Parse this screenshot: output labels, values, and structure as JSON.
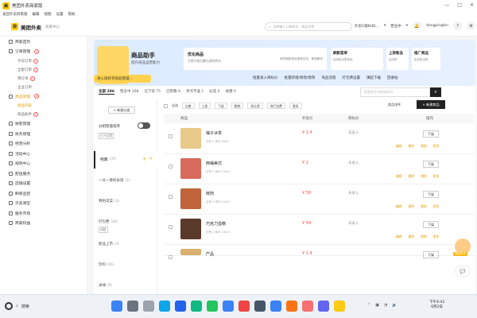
{
  "window": {
    "title": "美团外卖商家版",
    "controls": [
      "—",
      "□",
      "✕"
    ]
  },
  "menubar": [
    "美团外卖商家版",
    "编辑",
    "视图",
    "设置",
    "帮助"
  ],
  "header": {
    "brand": "美团外卖",
    "brand_sub": "商家中心",
    "search_placeholder": "支持输入订单尾号、商品名等",
    "store": "外卖C端KHD…",
    "status": "营业中",
    "user": "dongpingbin"
  },
  "sidebar": {
    "items": [
      {
        "label": "商家首页"
      },
      {
        "label": "订单管理",
        "badge": "1"
      },
      {
        "label": "今日订单",
        "sub": true,
        "badge": "1"
      },
      {
        "label": "全部订单",
        "sub": true,
        "badge": "2"
      },
      {
        "label": "预订单",
        "sub": true,
        "badge": "2"
      },
      {
        "label": "企业订单",
        "sub": true
      },
      {
        "label": "商品管理",
        "active": true,
        "badge": "4"
      },
      {
        "label": "商品列表",
        "sub": true,
        "active": true
      },
      {
        "label": "商品助手",
        "sub": true,
        "badge": "6"
      },
      {
        "label": "顾客管理"
      },
      {
        "label": "财务管理"
      },
      {
        "label": "经营分析"
      },
      {
        "label": "活动中心"
      },
      {
        "label": "规则中心"
      },
      {
        "label": "配送服务"
      },
      {
        "label": "店铺设置"
      },
      {
        "label": "刷单监控"
      },
      {
        "label": "外卖课堂"
      },
      {
        "label": "服务市场"
      },
      {
        "label": "商家权益"
      }
    ]
  },
  "banner": {
    "title": "商品助手",
    "subtitle": "提升商品运营能力",
    "card1": {
      "title": "优化商品",
      "desc": "可提升商品曝光度和转化",
      "right": "新时期新商品更受欢迎，敬请期待"
    },
    "card2": {
      "title": "刷新菜单",
      "desc": "如出售出售菜品"
    },
    "card3": {
      "title": "上架新品",
      "desc": "如出售"
    },
    "card4": {
      "title": "推广商品",
      "desc": "如出售出售"
    },
    "entry_button": "进入商好货商品管理 ›"
  },
  "actions": [
    "批量录入目标价",
    "批量新增/修改/修改",
    "商品流程",
    "打包费设置",
    "填起下载",
    "回收站"
  ],
  "tabs": [
    "全部 286",
    "售卖中 168",
    "已下架 75",
    "已售罄 6",
    "单点不送 1",
    "必选 0",
    "关键 0"
  ],
  "product_search_placeholder": "搜索商品名称或条码",
  "categories": {
    "add_button": "+ 新建分类",
    "smart_sort_label": "分组智能排序",
    "smart_sort_tag": "打开设置",
    "selected": "经典",
    "selected_count": "(37)",
    "items": [
      {
        "label": "一分一香奶米饭",
        "count": "(1)"
      },
      {
        "label": "特色凉菜",
        "count": "(3)"
      },
      {
        "label": "打包费",
        "count": "(26)",
        "sub": "调整"
      },
      {
        "label": "新品上市",
        "count": "(3)"
      },
      {
        "label": "饮料",
        "count": "(16)"
      },
      {
        "label": "米线",
        "count": "(9)"
      }
    ]
  },
  "toolbar": {
    "select_all": "全选",
    "buttons": [
      "出售",
      "上架",
      "下架",
      "删除",
      "改分类",
      "改打包费",
      "更多"
    ],
    "sort": "商品排序",
    "new_product": "+ 新建商品"
  },
  "table": {
    "headers": {
      "product": "商品",
      "price": "外卖价",
      "target": "目标价",
      "op": "操作"
    },
    "rows": [
      {
        "name": "柚子冰茶",
        "meta": "月售 0  库存 9996",
        "price": "¥ 1.4",
        "target": "未录入",
        "btn": "下架",
        "links": [
          "编辑",
          "删除",
          "替换",
          "更多"
        ]
      },
      {
        "name": "西柚美式",
        "meta": "月售 0  库存 10000",
        "price": "¥ 2",
        "target": "未录入",
        "btn": "下架",
        "links": [
          "编辑",
          "删除",
          "替换",
          "更多"
        ]
      },
      {
        "name": "鲜肉",
        "meta": "月售 0  库存 10000",
        "price": "¥ 58",
        "target": "未录入",
        "btn": "下架",
        "links": [
          "编辑",
          "删除",
          "替换",
          "更多"
        ]
      },
      {
        "name": "巧克力蛋糕",
        "meta": "月售 0  库存 10000",
        "price": "¥ 99",
        "target": "未录入",
        "btn": "下架",
        "links": [
          "编辑",
          "删除",
          "替换",
          "更多"
        ]
      },
      {
        "name": "产品",
        "meta": "",
        "price": "¥ 1.4",
        "target": "",
        "btn": "下架",
        "links": []
      }
    ]
  },
  "float": {
    "label": "商品助手"
  },
  "taskbar": {
    "search": "搜索",
    "time": "下午4:43",
    "date": "6月2日"
  },
  "colors": {
    "accent": "#ffcc00",
    "price": "#ff4d4f",
    "link": "#e8a000"
  }
}
